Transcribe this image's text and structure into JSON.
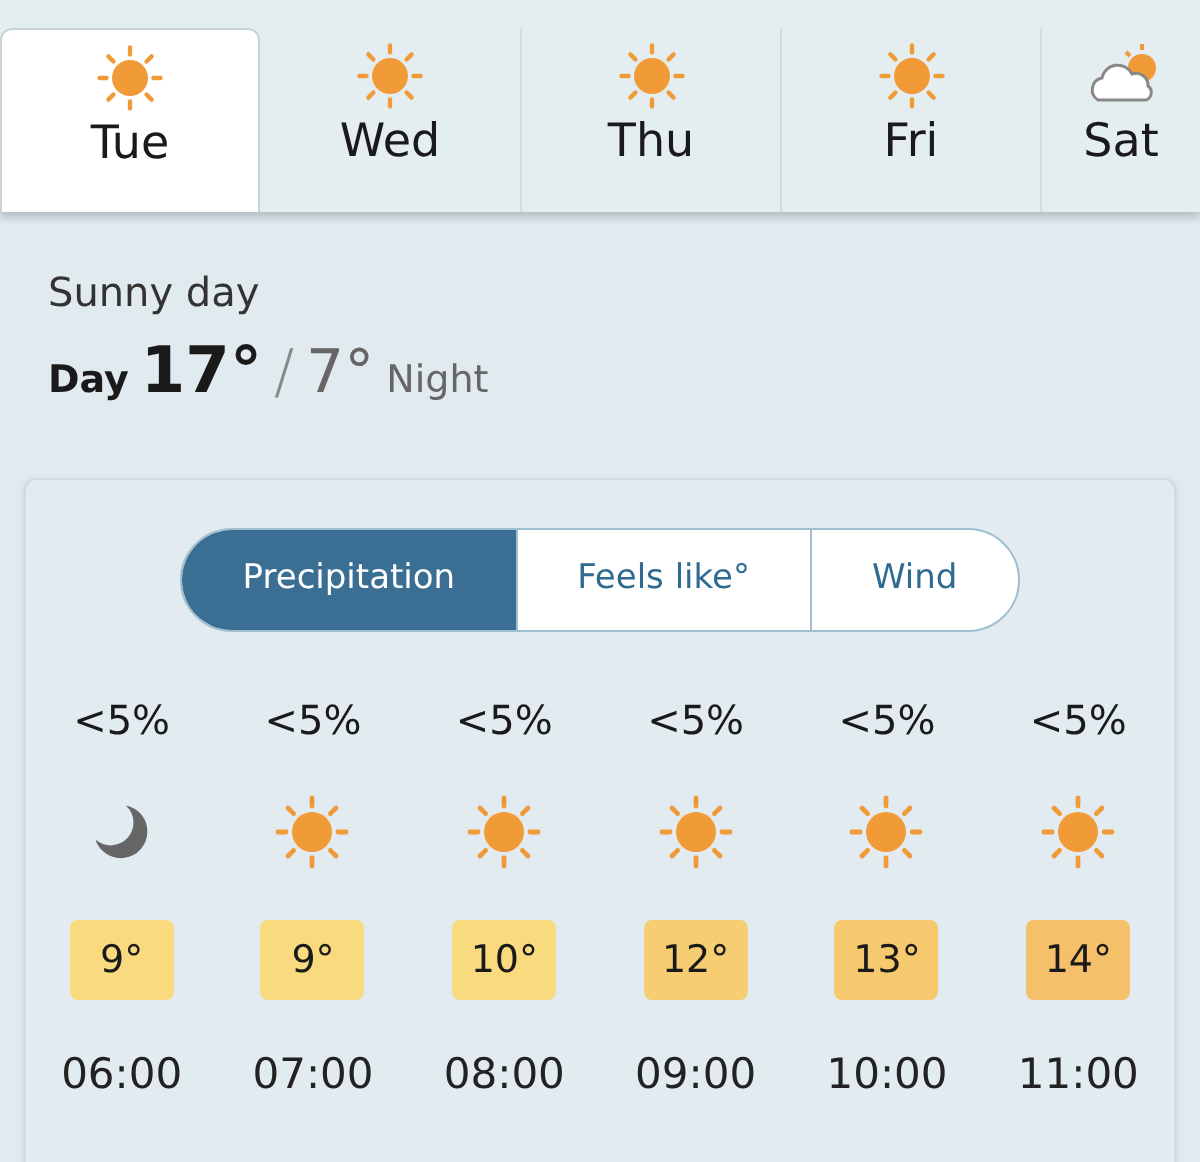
{
  "days": [
    {
      "label": "Tue",
      "kind": "sun",
      "selected": true
    },
    {
      "label": "Wed",
      "kind": "sun",
      "selected": false
    },
    {
      "label": "Thu",
      "kind": "sun",
      "selected": false
    },
    {
      "label": "Fri",
      "kind": "sun",
      "selected": false
    },
    {
      "label": "Sat",
      "kind": "cloud-sun",
      "selected": false
    }
  ],
  "summary": {
    "description": "Sunny day",
    "day_label": "Day",
    "day_temp": "17°",
    "separator": "/",
    "night_temp": "7°",
    "night_label": "Night"
  },
  "modes": [
    {
      "label": "Precipitation",
      "selected": true
    },
    {
      "label": "Feels like°",
      "selected": false
    },
    {
      "label": "Wind",
      "selected": false
    }
  ],
  "hours": [
    {
      "precip": "<5%",
      "kind": "moon",
      "temp": "9°",
      "color": "#f9da7e",
      "time": "06:00"
    },
    {
      "precip": "<5%",
      "kind": "sun",
      "temp": "9°",
      "color": "#f9da7e",
      "time": "07:00"
    },
    {
      "precip": "<5%",
      "kind": "sun",
      "temp": "10°",
      "color": "#f9da7e",
      "time": "08:00"
    },
    {
      "precip": "<5%",
      "kind": "sun",
      "temp": "12°",
      "color": "#f7cd73",
      "time": "09:00"
    },
    {
      "precip": "<5%",
      "kind": "sun",
      "temp": "13°",
      "color": "#f7c96f",
      "time": "10:00"
    },
    {
      "precip": "<5%",
      "kind": "sun",
      "temp": "14°",
      "color": "#f5c06a",
      "time": "11:00"
    }
  ]
}
